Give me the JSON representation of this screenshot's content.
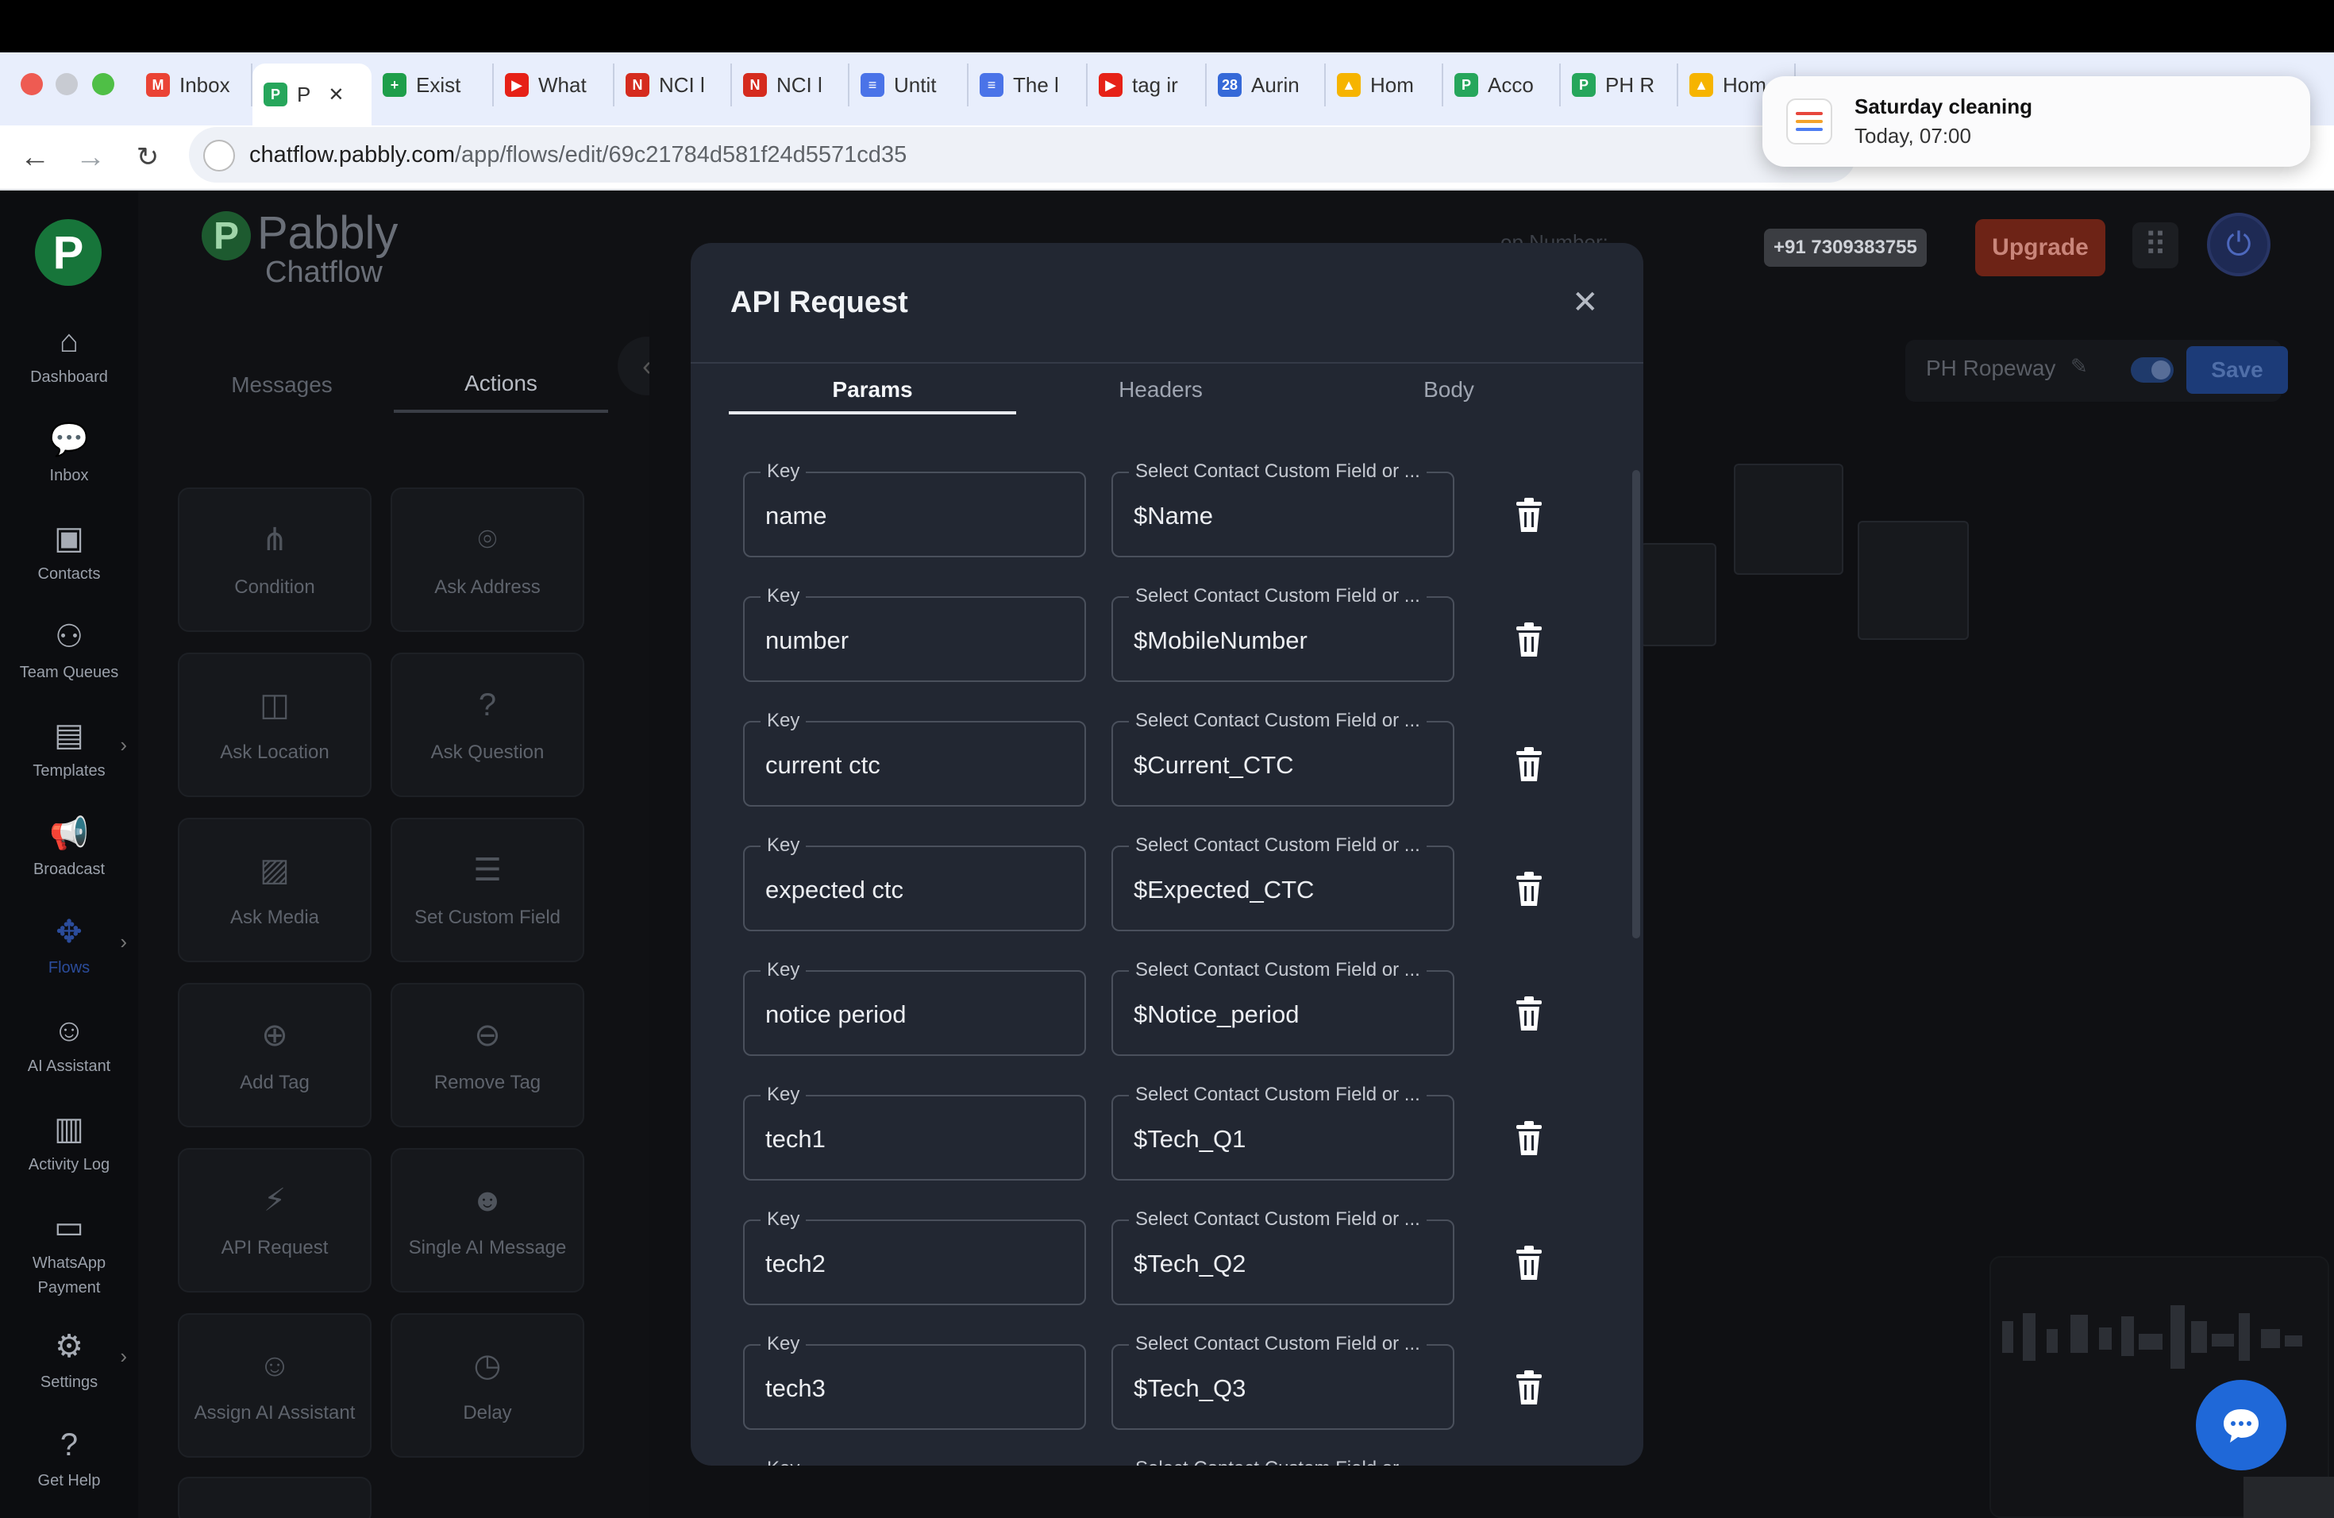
{
  "browser": {
    "tabs": [
      {
        "label": "Inbox",
        "icon": "gmail-icon",
        "color": "#ea4335"
      },
      {
        "label": "P",
        "icon": "pabbly-icon",
        "color": "#26a65b",
        "active": true
      },
      {
        "label": "Exist",
        "icon": "sheets-plus-icon",
        "color": "#1e9e4a"
      },
      {
        "label": "What",
        "icon": "youtube-icon",
        "color": "#e62117"
      },
      {
        "label": "NCI l",
        "icon": "nci-icon",
        "color": "#d52b1e"
      },
      {
        "label": "NCI l",
        "icon": "nci-icon",
        "color": "#d52b1e"
      },
      {
        "label": "Untit",
        "icon": "docs-icon",
        "color": "#4a73e8"
      },
      {
        "label": "The l",
        "icon": "docs-icon",
        "color": "#4a73e8"
      },
      {
        "label": "tag ir",
        "icon": "youtube-icon",
        "color": "#e62117"
      },
      {
        "label": "Aurin",
        "icon": "calendar-icon",
        "color": "#3569d8"
      },
      {
        "label": "Hom",
        "icon": "drive-icon",
        "color": "#f6b400"
      },
      {
        "label": "Acco",
        "icon": "pabbly-icon",
        "color": "#26a65b"
      },
      {
        "label": "PH R",
        "icon": "pabbly-icon",
        "color": "#26a65b"
      },
      {
        "label": "Hom",
        "icon": "drive-icon",
        "color": "#f6b400"
      }
    ],
    "url_host": "chatflow.pabbly.com",
    "url_path": "/app/flows/edit/69c21784d581f24d5571cd35"
  },
  "notification": {
    "title": "Saturday cleaning",
    "time": "Today, 07:00"
  },
  "brand": {
    "line1": "Pabbly",
    "line2": "Chatflow",
    "logo_letter": "P"
  },
  "sidebar": {
    "items": [
      {
        "label": "Dashboard",
        "icon": "home-icon"
      },
      {
        "label": "Inbox",
        "icon": "chat-bubbles-icon"
      },
      {
        "label": "Contacts",
        "icon": "contact-card-icon"
      },
      {
        "label": "Team Queues",
        "icon": "team-icon"
      },
      {
        "label": "Templates",
        "icon": "template-icon",
        "chevron": true
      },
      {
        "label": "Broadcast",
        "icon": "megaphone-icon"
      },
      {
        "label": "Flows",
        "icon": "flows-icon",
        "chevron": true,
        "active": true
      },
      {
        "label": "AI Assistant",
        "icon": "robot-icon"
      },
      {
        "label": "Activity Log",
        "icon": "activity-icon"
      },
      {
        "label": "WhatsApp Payment",
        "icon": "payment-icon"
      },
      {
        "label": "Settings",
        "icon": "gear-icon",
        "chevron": true
      },
      {
        "label": "Get Help",
        "icon": "help-icon"
      }
    ]
  },
  "panel": {
    "tabs": [
      "Messages",
      "Actions"
    ],
    "actions": [
      {
        "label": "Condition",
        "icon": "condition-icon"
      },
      {
        "label": "Ask Address",
        "icon": "location-pin-icon"
      },
      {
        "label": "Ask Location",
        "icon": "map-icon"
      },
      {
        "label": "Ask Question",
        "icon": "question-icon"
      },
      {
        "label": "Ask Media",
        "icon": "media-icon"
      },
      {
        "label": "Set Custom Field",
        "icon": "custom-field-icon"
      },
      {
        "label": "Add Tag",
        "icon": "tag-plus-icon"
      },
      {
        "label": "Remove Tag",
        "icon": "tag-minus-icon"
      },
      {
        "label": "API Request",
        "icon": "api-plug-icon"
      },
      {
        "label": "Single AI Message",
        "icon": "ai-message-icon"
      },
      {
        "label": "Assign AI Assistant",
        "icon": "ai-assistant-icon"
      },
      {
        "label": "Delay",
        "icon": "clock-icon"
      }
    ]
  },
  "header": {
    "number_label": "op Number:",
    "number_value": "+91 7309383755",
    "upgrade_label": "Upgrade"
  },
  "flow": {
    "name": "PH Ropeway",
    "save_label": "Save"
  },
  "modal": {
    "title": "API Request",
    "tabs": [
      "Params",
      "Headers",
      "Body"
    ],
    "key_label": "Key",
    "value_label": "Select Contact Custom Field or ...",
    "partial_value_label": "Select Contact Custom Field or",
    "params": [
      {
        "key": "name",
        "value": "$Name"
      },
      {
        "key": "number",
        "value": "$MobileNumber"
      },
      {
        "key": "current ctc",
        "value": "$Current_CTC"
      },
      {
        "key": "expected ctc",
        "value": "$Expected_CTC"
      },
      {
        "key": "notice period",
        "value": "$Notice_period"
      },
      {
        "key": "tech1",
        "value": "$Tech_Q1"
      },
      {
        "key": "tech2",
        "value": "$Tech_Q2"
      },
      {
        "key": "tech3",
        "value": "$Tech_Q3"
      },
      {
        "key": "",
        "value": ""
      }
    ]
  },
  "colors": {
    "accent": "#1f68d8",
    "brand_green": "#26a65b",
    "modal_bg": "#222732"
  }
}
